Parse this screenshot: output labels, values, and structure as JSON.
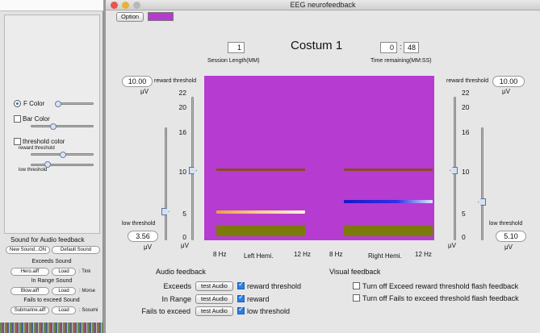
{
  "left_panel": {
    "f_color_label": "F Color",
    "bar_color_label": "Bar Color",
    "threshold_color_label": "threshold color",
    "reward_threshold_label": "reward threshold",
    "low_threshold_label": "low threshold",
    "sound_section_title": "Sound for Audio feedback",
    "new_sound_button": "New Sound...ON",
    "default_sound_button": "Default Sound",
    "exceeds_sound_title": "Exceeds Sound",
    "exceeds_file": "Hero.aiff",
    "exceeds_name": ": Tink",
    "in_range_sound_title": "In Range Sound",
    "in_range_file": "Blow.aiff",
    "in_range_name": ": Morse",
    "fails_sound_title": "Fails to exceed Sound",
    "fails_file": "Submarine.aiff",
    "fails_name": ": Sosumi",
    "load_label": "Load"
  },
  "window": {
    "title": "EEG neurofeedback",
    "option_button": "Option",
    "swatch_color": "#b63bd0",
    "session_length_value": "1",
    "session_length_label": "Session Length(MM)",
    "costum_title": "Costum 1",
    "time_remaining_min": "0",
    "time_remaining_sec": "48",
    "time_remaining_label": "Time remaining(MM:SS)"
  },
  "left_channel": {
    "reward_threshold_value": "10.00",
    "reward_threshold_label": "reward threshold",
    "reward_unit": "μV",
    "low_threshold_label": "low threshold",
    "low_threshold_value": "3.56",
    "low_unit": "μV",
    "ticks": [
      "22",
      "20",
      "16",
      "10",
      "5",
      "0"
    ],
    "axis_unit": "μV"
  },
  "right_channel": {
    "reward_threshold_value": "10.00",
    "reward_threshold_label": "reward threshold",
    "reward_unit": "μV",
    "low_threshold_label": "low threshold",
    "low_threshold_value": "5.10",
    "low_unit": "μV",
    "ticks": [
      "22",
      "20",
      "16",
      "10",
      "5",
      "0"
    ],
    "axis_unit": "μV"
  },
  "plot": {
    "x_left_start": "8  Hz",
    "x_left_mid": "Left Hemi.",
    "x_left_end": "12 Hz",
    "x_right_start": "8  Hz",
    "x_right_mid": "Right Hemi.",
    "x_right_end": "12 Hz",
    "bar_color": "#7d7a0c",
    "threshold_line_color": "#8b4a2a",
    "left_current_uv": 5,
    "right_current_uv": 7,
    "left_reward_uv": 10,
    "right_reward_uv": 10
  },
  "audio_feedback": {
    "title": "Audio feedback",
    "rows": [
      {
        "label": "Exceeds",
        "button": "test Audio",
        "check_label": "reward threshold"
      },
      {
        "label": "In Range",
        "button": "test Audio",
        "check_label": "reward"
      },
      {
        "label": "Fails to exceed",
        "button": "test Audio",
        "check_label": "low threshold"
      }
    ]
  },
  "visual_feedback": {
    "title": "Visual feedback",
    "option1": "Turn off Exceed reward threshold flash feedback",
    "option2": "Turn off Fails to exceed threshold flash feedback"
  }
}
